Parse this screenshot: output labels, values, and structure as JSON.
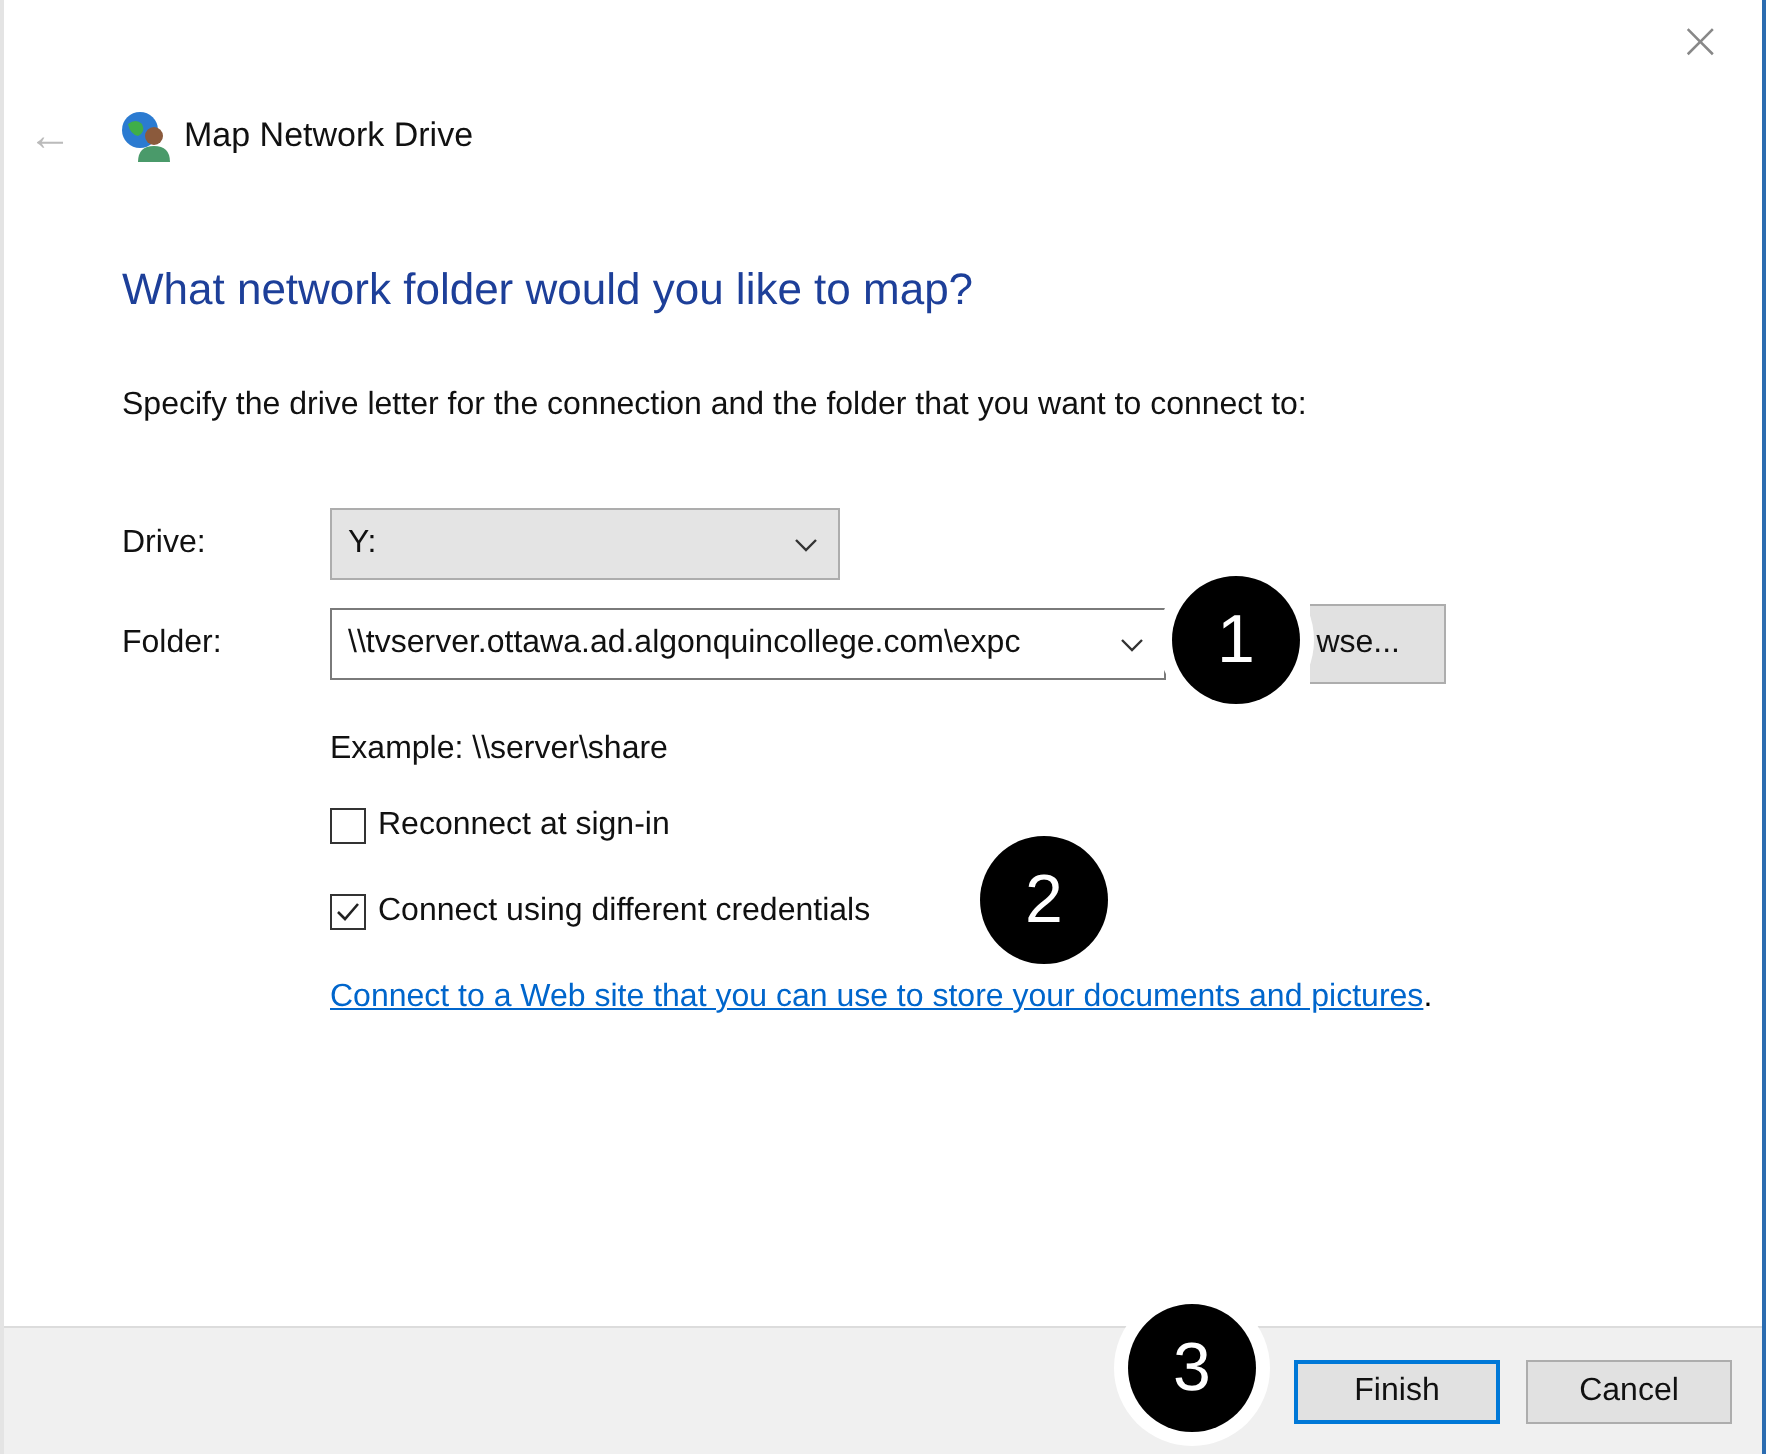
{
  "window": {
    "title": "Map Network Drive",
    "close": "×",
    "back": "←"
  },
  "heading": "What network folder would you like to map?",
  "instruction": "Specify the drive letter for the connection and the folder that you want to connect to:",
  "drive": {
    "label": "Drive:",
    "value": "Y:"
  },
  "folder": {
    "label": "Folder:",
    "value": "\\\\tvserver.ottawa.ad.algonquincollege.com\\expc",
    "browse_button": "wse..."
  },
  "example": "Example: \\\\server\\share",
  "options": [
    {
      "label": "Reconnect at sign-in",
      "checked": false
    },
    {
      "label": "Connect using different credentials",
      "checked": true
    }
  ],
  "link": {
    "text": "Connect to a Web site that you can use to store your documents and pictures",
    "trailing": "."
  },
  "buttons": [
    {
      "label": "Finish",
      "selected": true
    },
    {
      "label": "Cancel",
      "selected": false
    }
  ],
  "callouts": [
    {
      "label": "1"
    },
    {
      "label": "2"
    },
    {
      "label": "3"
    }
  ]
}
